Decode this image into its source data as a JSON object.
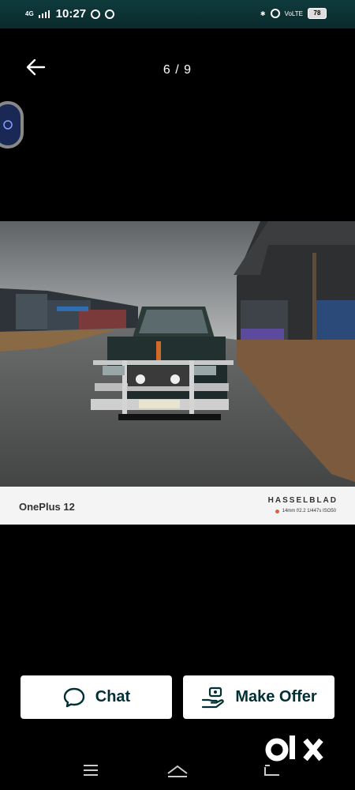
{
  "status_bar": {
    "network": "4G",
    "time": "10:27",
    "battery": "78",
    "right_network": "VoLTE"
  },
  "header": {
    "counter": "6 / 9"
  },
  "photo": {
    "camera_model": "OnePlus 12",
    "camera_brand": "HASSELBLAD",
    "camera_specs": "14mm f/2.2 1/447s ISO50"
  },
  "actions": {
    "chat_label": "Chat",
    "make_offer_label": "Make Offer"
  },
  "logo": {
    "text": "olx"
  }
}
